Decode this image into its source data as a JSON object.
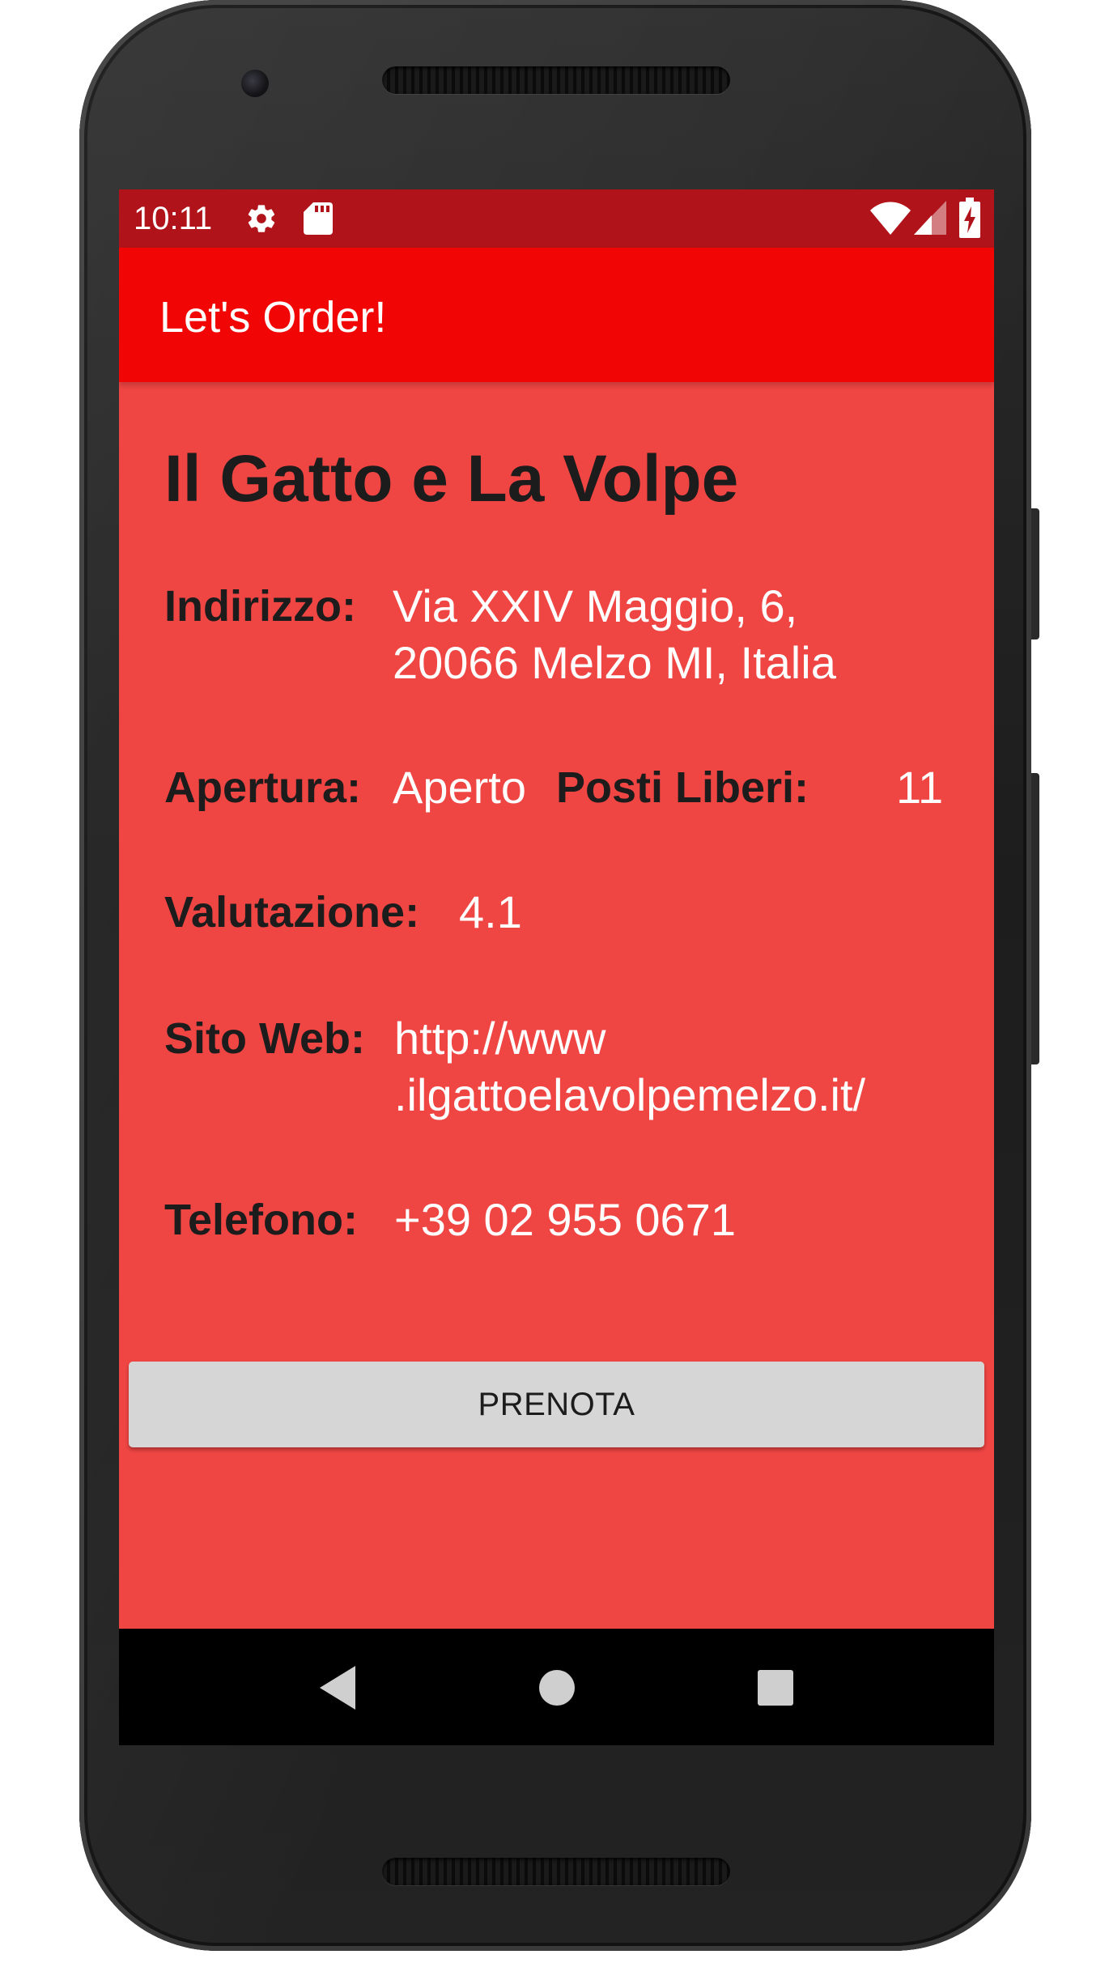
{
  "statusbar": {
    "time": "10:11",
    "icons": [
      "gear-icon",
      "sd-card-icon",
      "wifi-icon",
      "signal-icon",
      "battery-charging-icon"
    ]
  },
  "appbar": {
    "title": "Let's Order!"
  },
  "restaurant": {
    "name": "Il Gatto e La Volpe",
    "address_label": "Indirizzo:",
    "address_line1": "Via XXIV Maggio, 6,",
    "address_line2": "20066 Melzo MI, Italia",
    "opening_label": "Apertura:",
    "opening_value": "Aperto",
    "seats_label": "Posti Liberi:",
    "seats_value": "11",
    "rating_label": "Valutazione:",
    "rating_value": "4.1",
    "website_label": "Sito Web:",
    "website_line1": "http://www",
    "website_line2": ".ilgattoelavolpemelzo.it/",
    "phone_label": "Telefono:",
    "phone_value": "+39 02 955 0671"
  },
  "actions": {
    "book_label": "PRENOTA"
  },
  "navbar": {
    "icons": [
      "back-icon",
      "home-icon",
      "recents-icon"
    ]
  },
  "colors": {
    "status_bar": "#b0141a",
    "app_bar": "#f20505",
    "background": "#ef4543",
    "button": "#d6d6d6"
  }
}
